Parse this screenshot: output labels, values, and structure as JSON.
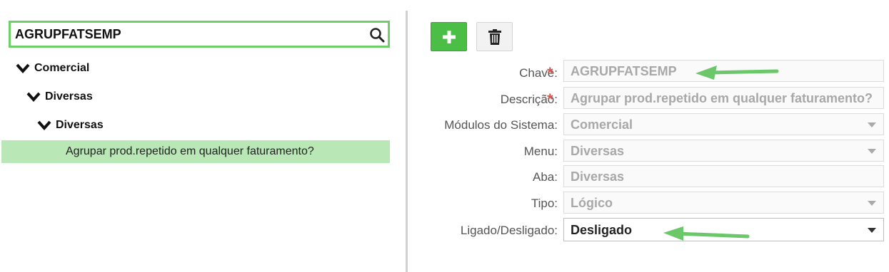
{
  "search": {
    "value": "AGRUPFATSEMP",
    "icon": "search-icon"
  },
  "tree": {
    "level1": "Comercial",
    "level2": "Diversas",
    "level3": "Diversas",
    "leaf": "Agrupar prod.repetido em qualquer faturamento?"
  },
  "toolbar": {
    "add_icon": "plus-icon",
    "delete_icon": "trash-icon"
  },
  "form": {
    "chave": {
      "label": "Chave:",
      "value": "AGRUPFATSEMP",
      "required": true
    },
    "descricao": {
      "label": "Descrição:",
      "value": "Agrupar prod.repetido em qualquer faturamento?",
      "required": true
    },
    "modulos": {
      "label": "Módulos do Sistema:",
      "value": "Comercial"
    },
    "menu": {
      "label": "Menu:",
      "value": "Diversas"
    },
    "aba": {
      "label": "Aba:",
      "value": "Diversas"
    },
    "tipo": {
      "label": "Tipo:",
      "value": "Lógico"
    },
    "ligado": {
      "label": "Ligado/Desligado:",
      "value": "Desligado"
    },
    "required_mark": "*"
  },
  "colors": {
    "accent_green": "#4bbf45",
    "selection_green": "#b9e7b6",
    "required_red": "#d9534f"
  }
}
